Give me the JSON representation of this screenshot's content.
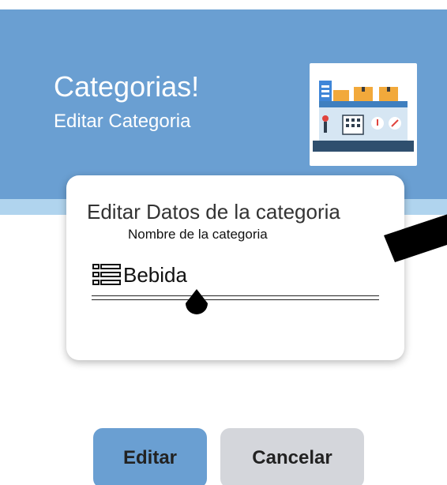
{
  "header": {
    "title": "Categorias!",
    "subtitle": "Editar Categoria",
    "logo_icon": "store-shelf-icon",
    "background_color": "#6a9fd2",
    "strip_color": "#b0d4ee"
  },
  "card": {
    "title": "Editar Datos de la categoria",
    "field_label": "Nombre de la categoria",
    "field_icon": "list-icon",
    "field_value": "Bebida"
  },
  "buttons": {
    "edit_label": "Editar",
    "cancel_label": "Cancelar",
    "edit_color": "#6a9fd2",
    "cancel_color": "#d4d6db"
  }
}
